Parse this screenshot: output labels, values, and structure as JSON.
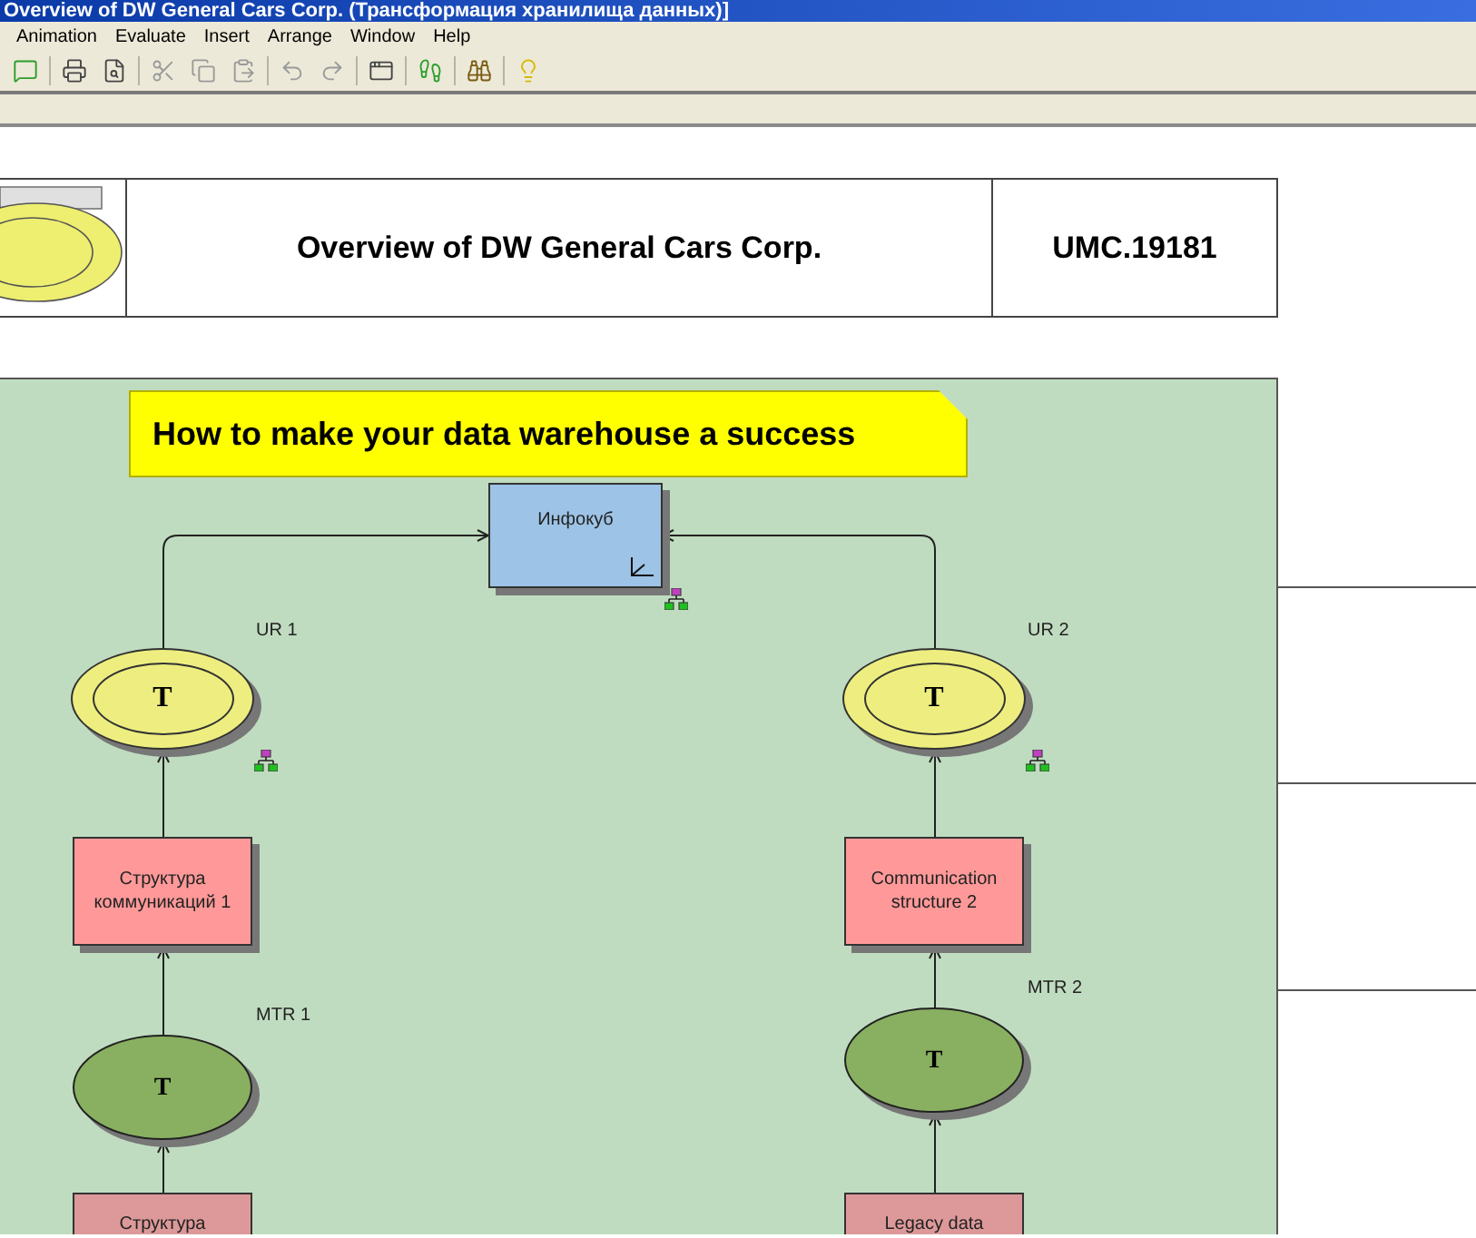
{
  "window": {
    "title": "Overview of DW General Cars Corp. (Трансформация хранилища данных)]"
  },
  "menu": [
    {
      "label": "Animation"
    },
    {
      "label": "Evaluate"
    },
    {
      "label": "Insert"
    },
    {
      "label": "Arrange"
    },
    {
      "label": "Window"
    },
    {
      "label": "Help"
    }
  ],
  "header": {
    "title": "Overview of DW General Cars Corp.",
    "code": "UMC.19181"
  },
  "diagram": {
    "note": "How to make your data warehouse a success",
    "infocube": {
      "label": "Инфокуб"
    },
    "flows": [
      {
        "update_rule": {
          "symbol": "T",
          "caption": "UR 1"
        },
        "comm_structure": {
          "label": "Структура коммуникаций 1"
        },
        "transfer_rule": {
          "symbol": "T",
          "caption": "MTR 1"
        },
        "source": {
          "label": "Структура"
        }
      },
      {
        "update_rule": {
          "symbol": "T",
          "caption": "UR 2"
        },
        "comm_structure": {
          "label": "Communication structure 2"
        },
        "transfer_rule": {
          "symbol": "T",
          "caption": "MTR 2"
        },
        "source": {
          "label": "Legacy data"
        }
      }
    ]
  }
}
